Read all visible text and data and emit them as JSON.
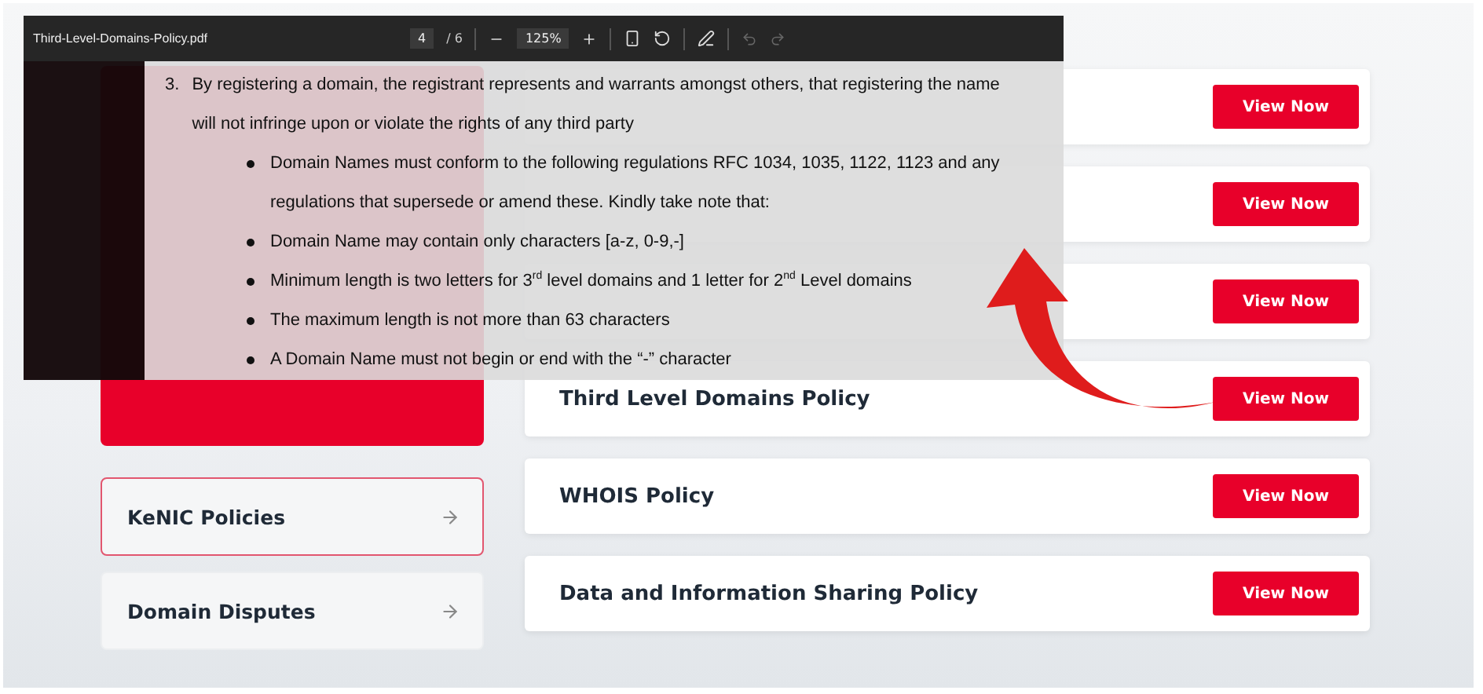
{
  "pdf_viewer": {
    "file_name": "Third-Level-Domains-Policy.pdf",
    "page_current": "4",
    "page_separator": "/",
    "page_total": "6",
    "zoom": "125%",
    "undo_disabled": true,
    "redo_disabled": true,
    "document": {
      "item_number": "3.",
      "paragraph": "By registering a domain, the registrant represents and warrants amongst others, that registering the name will not infringe upon or violate the rights of any third party",
      "bullets": [
        "Domain Names must conform to the following regulations RFC 1034, 1035, 1122, 1123 and any regulations that supersede or amend these. Kindly take note that:",
        "Domain Name may contain only characters [a-z, 0-9,-]",
        "Minimum length is two letters for 3$^{rd}$ level domains and 1 letter for 2$^{nd}$ Level domains",
        "The maximum length is not more than 63 characters",
        "A Domain Name must not begin or end with the “-” character"
      ]
    }
  },
  "sidebar": {
    "items": [
      {
        "label": "KeNIC Policies",
        "selected": true
      },
      {
        "label": "Domain Disputes",
        "selected": false
      }
    ]
  },
  "policies": [
    {
      "button": "View Now"
    },
    {
      "button": "View Now"
    },
    {
      "button": "View Now"
    },
    {
      "title": "Third Level Domains Policy",
      "button": "View Now"
    },
    {
      "title": "WHOIS Policy",
      "button": "View Now"
    },
    {
      "title": "Data and Information Sharing Policy",
      "button": "View Now"
    }
  ]
}
